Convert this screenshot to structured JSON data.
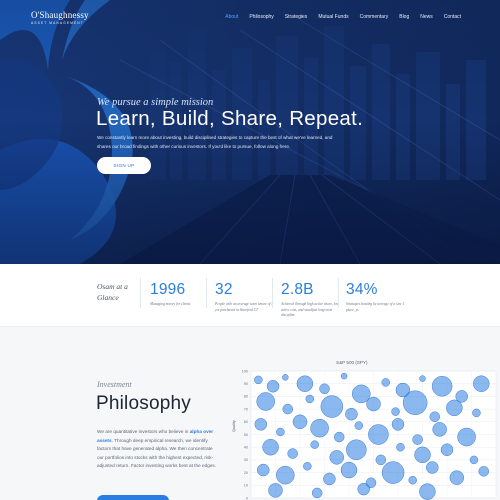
{
  "brand": {
    "name": "O'Shaughnessy",
    "sub": "ASSET MANAGEMENT"
  },
  "nav": [
    "About",
    "Philosophy",
    "Strategies",
    "Mutual Funds",
    "Commentary",
    "Blog",
    "News",
    "Contact"
  ],
  "nav_active": "About",
  "hero": {
    "tagline": "We pursue a simple mission",
    "headline": "Learn, Build, Share, Repeat.",
    "description": "We constantly learn more about investing, build disciplined strategies to capture the best of what we've learned, and shares our broad findings with other curious investors. If you'd like to pursue, follow along here.",
    "cta": "SIGN UP"
  },
  "glance": {
    "title": "Osam at a Glance"
  },
  "stats": [
    {
      "value": "1996",
      "label": "Managing money for clients"
    },
    {
      "value": "32",
      "label": "People with an average team tenure of 8 yrs purchased in Stamford CT"
    },
    {
      "value": "2.8B",
      "label": "Achieved through high active share, low active cost, and steadfast long-term discipline"
    },
    {
      "value": "34%",
      "label": "Strategies beating by average of a size 1 place, ys"
    }
  ],
  "philosophy": {
    "kicker": "Investment",
    "title": "Philosophy",
    "text_before": "We are quantitative investors who believe in ",
    "highlight": "alpha over assets",
    "text_after": ". Through deep empirical research, we identify factors that have generated alpha. We then concentrate our portfolios into stocks with the highest expected, risk-adjusted return. Factor investing works best at the edges."
  },
  "chart_data": {
    "type": "scatter",
    "title": "S&P 500 (SPY)",
    "ylabel": "Quality",
    "yticks": [
      "100",
      "90",
      "80",
      "70",
      "60",
      "50",
      "40",
      "30",
      "20",
      "10",
      "0"
    ],
    "ylim": [
      0,
      100
    ],
    "grid": true,
    "color": "#2a7de1",
    "points": [
      {
        "x": 3,
        "y": 93,
        "r": 4
      },
      {
        "x": 9,
        "y": 88,
        "r": 6
      },
      {
        "x": 14,
        "y": 95,
        "r": 3
      },
      {
        "x": 22,
        "y": 90,
        "r": 8
      },
      {
        "x": 30,
        "y": 86,
        "r": 5
      },
      {
        "x": 38,
        "y": 96,
        "r": 3
      },
      {
        "x": 45,
        "y": 82,
        "r": 9
      },
      {
        "x": 55,
        "y": 91,
        "r": 4
      },
      {
        "x": 62,
        "y": 85,
        "r": 7
      },
      {
        "x": 70,
        "y": 94,
        "r": 3
      },
      {
        "x": 78,
        "y": 88,
        "r": 10
      },
      {
        "x": 86,
        "y": 80,
        "r": 6
      },
      {
        "x": 94,
        "y": 90,
        "r": 8
      },
      {
        "x": 6,
        "y": 76,
        "r": 9
      },
      {
        "x": 15,
        "y": 70,
        "r": 5
      },
      {
        "x": 24,
        "y": 78,
        "r": 4
      },
      {
        "x": 33,
        "y": 72,
        "r": 11
      },
      {
        "x": 41,
        "y": 66,
        "r": 6
      },
      {
        "x": 50,
        "y": 74,
        "r": 7
      },
      {
        "x": 59,
        "y": 68,
        "r": 4
      },
      {
        "x": 67,
        "y": 75,
        "r": 12
      },
      {
        "x": 75,
        "y": 64,
        "r": 5
      },
      {
        "x": 83,
        "y": 71,
        "r": 8
      },
      {
        "x": 92,
        "y": 67,
        "r": 4
      },
      {
        "x": 4,
        "y": 58,
        "r": 6
      },
      {
        "x": 12,
        "y": 52,
        "r": 4
      },
      {
        "x": 20,
        "y": 60,
        "r": 7
      },
      {
        "x": 28,
        "y": 55,
        "r": 9
      },
      {
        "x": 36,
        "y": 48,
        "r": 5
      },
      {
        "x": 44,
        "y": 57,
        "r": 4
      },
      {
        "x": 52,
        "y": 50,
        "r": 10
      },
      {
        "x": 60,
        "y": 58,
        "r": 6
      },
      {
        "x": 68,
        "y": 46,
        "r": 5
      },
      {
        "x": 77,
        "y": 54,
        "r": 7
      },
      {
        "x": 88,
        "y": 48,
        "r": 9
      },
      {
        "x": 8,
        "y": 40,
        "r": 8
      },
      {
        "x": 17,
        "y": 35,
        "r": 5
      },
      {
        "x": 26,
        "y": 42,
        "r": 4
      },
      {
        "x": 35,
        "y": 32,
        "r": 7
      },
      {
        "x": 43,
        "y": 38,
        "r": 10
      },
      {
        "x": 53,
        "y": 30,
        "r": 5
      },
      {
        "x": 61,
        "y": 40,
        "r": 4
      },
      {
        "x": 70,
        "y": 34,
        "r": 8
      },
      {
        "x": 80,
        "y": 38,
        "r": 6
      },
      {
        "x": 91,
        "y": 30,
        "r": 4
      },
      {
        "x": 5,
        "y": 22,
        "r": 6
      },
      {
        "x": 14,
        "y": 18,
        "r": 9
      },
      {
        "x": 23,
        "y": 25,
        "r": 4
      },
      {
        "x": 32,
        "y": 15,
        "r": 6
      },
      {
        "x": 40,
        "y": 22,
        "r": 8
      },
      {
        "x": 49,
        "y": 12,
        "r": 5
      },
      {
        "x": 58,
        "y": 20,
        "r": 11
      },
      {
        "x": 66,
        "y": 14,
        "r": 4
      },
      {
        "x": 74,
        "y": 24,
        "r": 6
      },
      {
        "x": 84,
        "y": 16,
        "r": 7
      },
      {
        "x": 95,
        "y": 21,
        "r": 5
      },
      {
        "x": 10,
        "y": 6,
        "r": 7
      },
      {
        "x": 27,
        "y": 4,
        "r": 5
      },
      {
        "x": 46,
        "y": 7,
        "r": 6
      },
      {
        "x": 72,
        "y": 5,
        "r": 8
      }
    ]
  }
}
